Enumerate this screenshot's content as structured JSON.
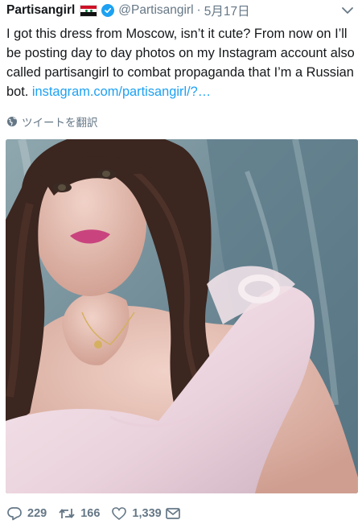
{
  "tweet": {
    "author_name": "Partisangirl",
    "handle": "@Partisangirl",
    "separator": "·",
    "date": "5月17日",
    "text": "I got this dress from Moscow, isn’t it cute? From now on I’ll be posting day to day photos on my Instagram account also called partisangirl to combat propaganda that I’m a Russian bot. ",
    "link_text": "instagram.com/partisangirl/?…",
    "translate_label": "ツイートを翻訳"
  },
  "icons": {
    "flag": "syria-flag-icon",
    "verified": "verified-badge-icon",
    "menu": "chevron-down-icon",
    "translate": "globe-icon",
    "reply": "reply-icon",
    "retweet": "retweet-icon",
    "like": "heart-icon",
    "dm": "envelope-icon"
  },
  "actions": {
    "reply_count": "229",
    "retweet_count": "166",
    "like_count": "1,339"
  },
  "colors": {
    "link": "#1da1f2",
    "secondary_text": "#657786",
    "primary_text": "#14171a"
  }
}
